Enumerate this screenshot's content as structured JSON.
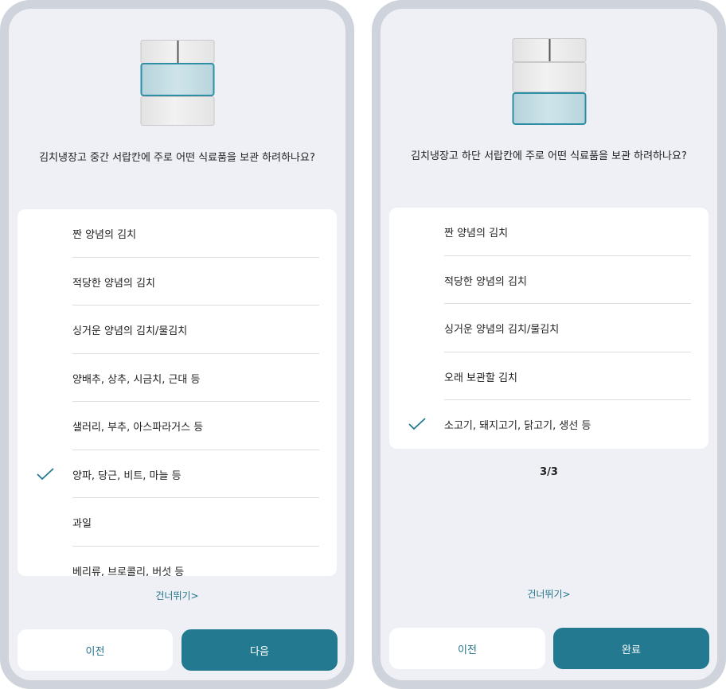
{
  "colors": {
    "accent": "#237a90",
    "background": "#eff0f5",
    "highlight_drawer": "#cfe4ea"
  },
  "left_screen": {
    "question": "김치냉장고 중간 서랍칸에 주로 어떤 식료품을 보관 하려하나요?",
    "options": [
      {
        "label": "짠 양념의 김치",
        "selected": false
      },
      {
        "label": "적당한 양념의 김치",
        "selected": false
      },
      {
        "label": "싱거운 양념의 김치/물김치",
        "selected": false
      },
      {
        "label": "양배추, 상추, 시금치, 근대 등",
        "selected": false
      },
      {
        "label": "샐러리, 부추, 아스파라거스 등",
        "selected": false
      },
      {
        "label": "양파, 당근, 비트, 마늘 등",
        "selected": true
      },
      {
        "label": "과일",
        "selected": false
      },
      {
        "label": "베리류, 브로콜리, 버섯 등",
        "selected": false
      }
    ],
    "skip_label": "건너뛰기>",
    "prev_label": "이전",
    "next_label": "다음"
  },
  "right_screen": {
    "question": "김치냉장고 하단 서랍칸에 주로 어떤 식료품을 보관 하려하나요?",
    "options": [
      {
        "label": "짠 양념의 김치",
        "selected": false
      },
      {
        "label": "적당한 양념의 김치",
        "selected": false
      },
      {
        "label": "싱거운 양념의 김치/물김치",
        "selected": false
      },
      {
        "label": "오래 보관할 김치",
        "selected": false
      },
      {
        "label": "소고기, 돼지고기, 닭고기, 생선 등",
        "selected": true
      }
    ],
    "page_indicator": "3/3",
    "skip_label": "건너뛰기>",
    "prev_label": "이전",
    "done_label": "완료"
  }
}
